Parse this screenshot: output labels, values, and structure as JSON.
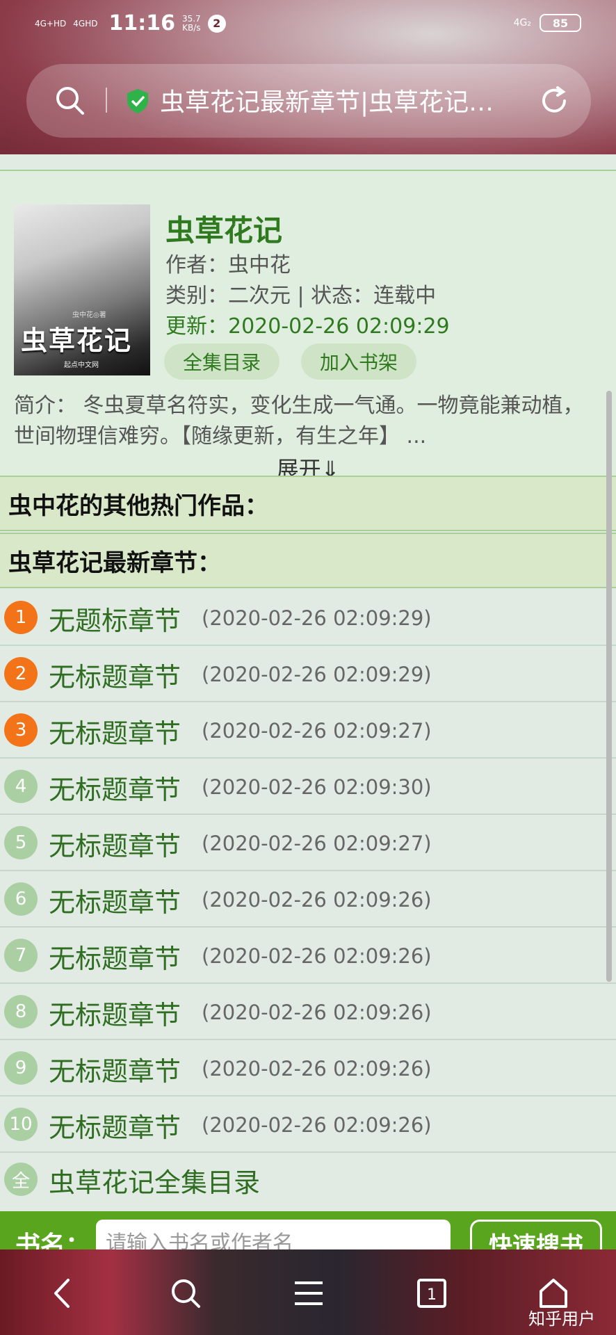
{
  "status": {
    "net1": "4G+HD",
    "net2": "4GHD",
    "time": "11:16",
    "speed": "35.7",
    "speed_unit": "KB/s",
    "badge": "2",
    "right_net": "4G₂",
    "battery": "85"
  },
  "address": {
    "title": "虫草花记最新章节|虫草花记…"
  },
  "book": {
    "title": "虫草花记",
    "author": "作者：虫中花",
    "category": "类别：二次元 | 状态：连载中",
    "updated": "更新：2020-02-26 02:09:29",
    "btn_catalog": "全集目录",
    "btn_shelf": "加入书架",
    "intro": "简介： 冬虫夏草名符实，变化生成一气通。一物竟能兼动植，世间物理信难穷。【随缘更新，有生之年】 ...",
    "expand": "展开⇓",
    "cover_title": "虫草花记",
    "cover_author": "虫中花◎著",
    "cover_pub": "起点中文网"
  },
  "sections": {
    "other_works": "虫中花的其他热门作品：",
    "latest": "虫草花记最新章节："
  },
  "chapters": [
    {
      "num": "1",
      "title": "无题标章节",
      "date": "(2020-02-26 02:09:29)"
    },
    {
      "num": "2",
      "title": "无标题章节",
      "date": "(2020-02-26 02:09:29)"
    },
    {
      "num": "3",
      "title": "无标题章节",
      "date": "(2020-02-26 02:09:27)"
    },
    {
      "num": "4",
      "title": "无标题章节",
      "date": "(2020-02-26 02:09:30)"
    },
    {
      "num": "5",
      "title": "无标题章节",
      "date": "(2020-02-26 02:09:27)"
    },
    {
      "num": "6",
      "title": "无标题章节",
      "date": "(2020-02-26 02:09:26)"
    },
    {
      "num": "7",
      "title": "无标题章节",
      "date": "(2020-02-26 02:09:26)"
    },
    {
      "num": "8",
      "title": "无标题章节",
      "date": "(2020-02-26 02:09:26)"
    },
    {
      "num": "9",
      "title": "无标题章节",
      "date": "(2020-02-26 02:09:26)"
    },
    {
      "num": "10",
      "title": "无标题章节",
      "date": "(2020-02-26 02:09:26)"
    }
  ],
  "full_catalog": {
    "badge": "全",
    "label": "虫草花记全集目录"
  },
  "search": {
    "label": "书名：",
    "placeholder": "请输入书名或作者名",
    "button": "快速搜书"
  },
  "nav": {
    "tabs_count": "1",
    "watermark": "知乎用户"
  },
  "colors": {
    "accent_green": "#2f7a1f",
    "hot_orange": "#f27318",
    "bar_green": "#5aa51e"
  }
}
